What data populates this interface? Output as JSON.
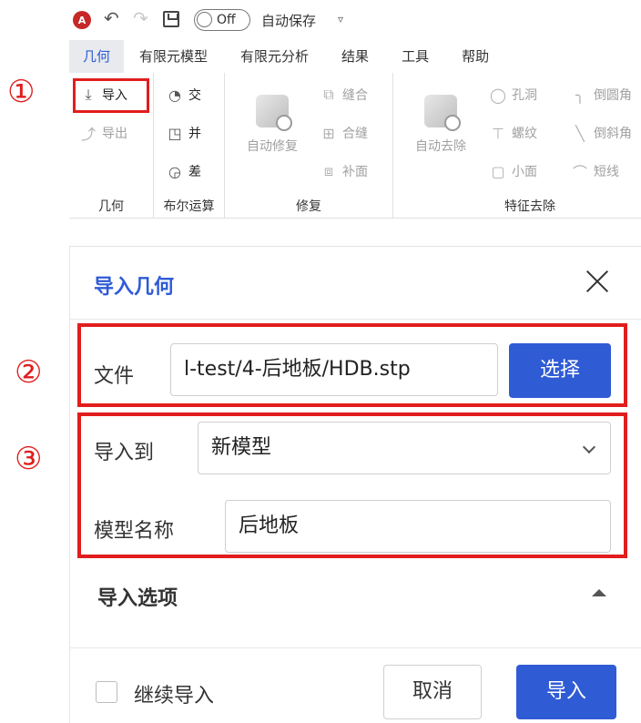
{
  "qat": {
    "logo": "A",
    "toggle_label": "Off",
    "autosave_label": "自动保存"
  },
  "tabs": [
    {
      "label": "几何",
      "active": true
    },
    {
      "label": "有限元模型"
    },
    {
      "label": "有限元分析"
    },
    {
      "label": "结果"
    },
    {
      "label": "工具"
    },
    {
      "label": "帮助"
    }
  ],
  "ribbon": {
    "geometry": {
      "label": "几何",
      "import": "导入",
      "export": "导出"
    },
    "boolean": {
      "label": "布尔运算",
      "intersect": "交",
      "union": "并",
      "subtract": "差"
    },
    "repair": {
      "label": "修复",
      "auto_repair": "自动修复",
      "stitch": "缝合",
      "merge_seam": "合缝",
      "patch": "补面"
    },
    "feature_removal": {
      "label": "特征去除",
      "auto_remove": "自动去除",
      "hole": "孔洞",
      "thread": "螺纹",
      "small_face": "小面",
      "fillet": "倒圆角",
      "chamfer": "倒斜角",
      "short_edge": "短线"
    }
  },
  "steps": [
    "①",
    "②",
    "③"
  ],
  "dialog": {
    "title": "导入几何",
    "file_label": "文件",
    "file_value": "l-test/4-后地板/HDB.stp",
    "select_button": "选择",
    "import_to_label": "导入到",
    "import_to_value": "新模型",
    "model_name_label": "模型名称",
    "model_name_value": "后地板",
    "options_section": "导入选项",
    "continue_import": "继续导入",
    "cancel_button": "取消",
    "import_button": "导入"
  },
  "colors": {
    "accent": "#2f5bd4",
    "highlight": "#e11d1d"
  }
}
